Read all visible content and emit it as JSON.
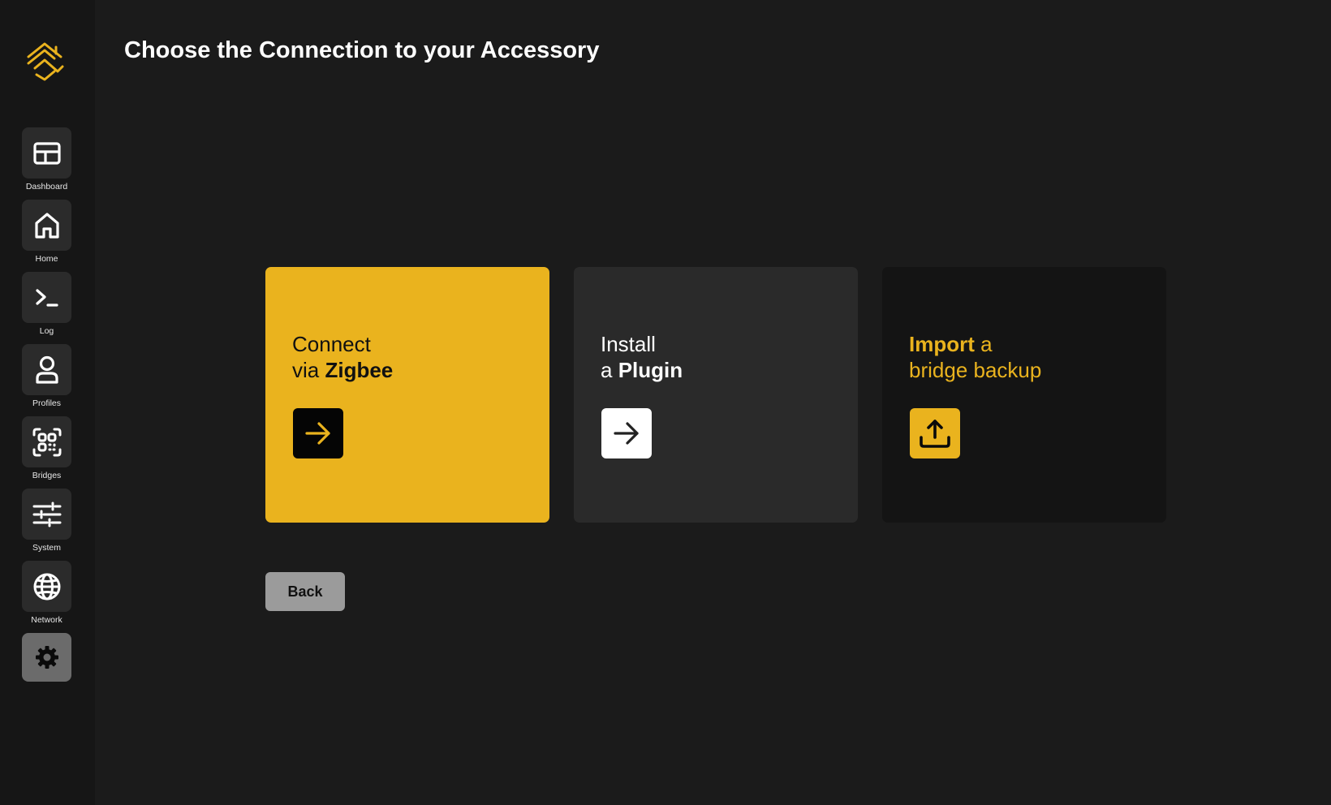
{
  "page": {
    "title": "Choose the Connection to your Accessory"
  },
  "sidebar": {
    "logo_icon": "house-chevron-logo-icon",
    "items": [
      {
        "label": "Dashboard",
        "icon": "dashboard-icon"
      },
      {
        "label": "Home",
        "icon": "home-icon"
      },
      {
        "label": "Log",
        "icon": "terminal-icon"
      },
      {
        "label": "Profiles",
        "icon": "user-icon"
      },
      {
        "label": "Bridges",
        "icon": "bridges-scan-icon"
      },
      {
        "label": "System",
        "icon": "sliders-icon"
      },
      {
        "label": "Network",
        "icon": "globe-icon"
      }
    ],
    "settings_icon": "gear-icon"
  },
  "cards": {
    "zigbee": {
      "line1": "Connect",
      "line2_prefix": "via ",
      "line2_bold": "Zigbee",
      "action_icon": "arrow-right-icon"
    },
    "plugin": {
      "line1": "Install",
      "line2_prefix": "a ",
      "line2_bold": "Plugin",
      "action_icon": "arrow-right-icon"
    },
    "backup": {
      "line1_bold": "Import",
      "line1_suffix": " a",
      "line2": "bridge backup",
      "action_icon": "upload-icon"
    }
  },
  "actions": {
    "back_label": "Back"
  },
  "colors": {
    "background": "#1b1b1b",
    "sidebar": "#161616",
    "accent": "#eab31e",
    "card_dark": "#2a2a2a",
    "card_darker": "#141414",
    "back_button": "#9b9b9b"
  }
}
